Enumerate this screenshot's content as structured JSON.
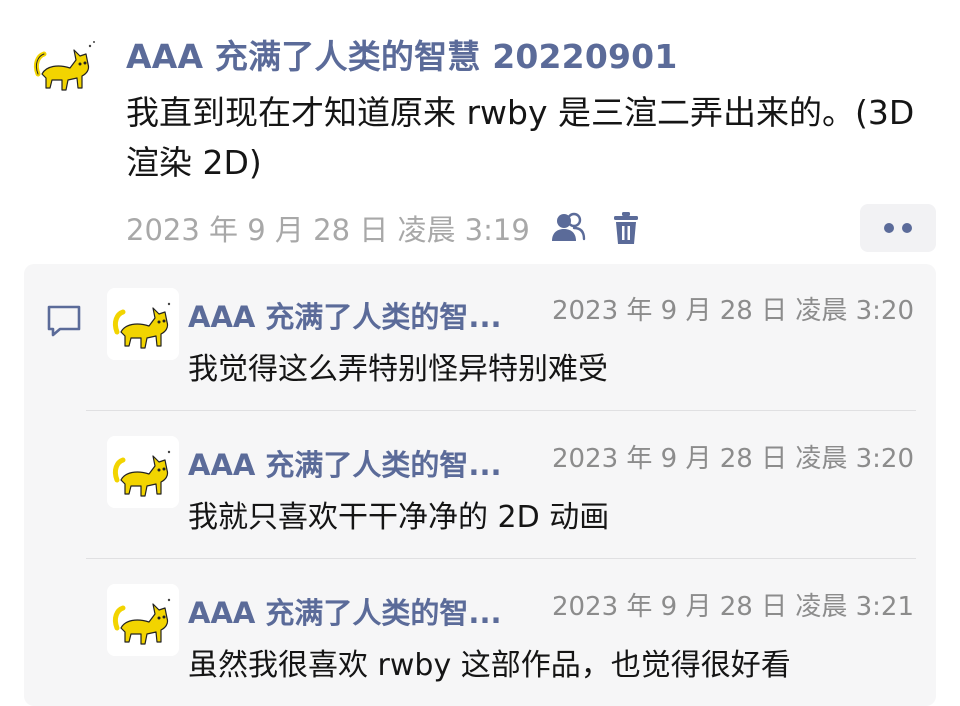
{
  "post": {
    "author": "AAA 充满了人类的智慧 20220901",
    "text": "我直到现在才知道原来 rwby 是三渲二弄出来的。(3D 渲染 2D)",
    "time": "2023 年 9 月 28 日 凌晨 3:19",
    "avatar_icon": "yellow-cat-avatar",
    "actions": [
      "people-icon",
      "trash-icon",
      "more-icon"
    ]
  },
  "comments": {
    "icon": "comment-bubble-icon",
    "items": [
      {
        "author": "AAA 充满了人类的智...",
        "time": "2023 年 9 月 28 日 凌晨 3:20",
        "text": "我觉得这么弄特别怪异特别难受"
      },
      {
        "author": "AAA 充满了人类的智...",
        "time": "2023 年 9 月 28 日 凌晨 3:20",
        "text": "我就只喜欢干干净净的 2D 动画"
      },
      {
        "author": "AAA 充满了人类的智...",
        "time": "2023 年 9 月 28 日 凌晨 3:21",
        "text": "虽然我很喜欢 rwby 这部作品，也觉得很好看"
      }
    ]
  },
  "colors": {
    "accent": "#5b6b99",
    "muted": "#a8a8a8",
    "panel": "#f6f6f7",
    "cat": "#f2d400"
  }
}
